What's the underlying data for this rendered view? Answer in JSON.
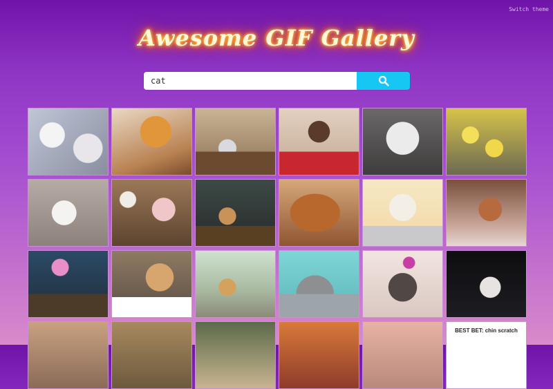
{
  "header": {
    "switch_theme": "Switch theme",
    "title": "Awesome GIF Gallery"
  },
  "search": {
    "value": "cat",
    "button_icon": "search-icon",
    "button_color": "#16c7f4"
  },
  "gallery": {
    "tiles": [
      {
        "icon": "gif-thumbnail"
      },
      {
        "icon": "gif-thumbnail"
      },
      {
        "icon": "gif-thumbnail"
      },
      {
        "icon": "gif-thumbnail"
      },
      {
        "icon": "gif-thumbnail"
      },
      {
        "icon": "gif-thumbnail"
      },
      {
        "icon": "gif-thumbnail"
      },
      {
        "icon": "gif-thumbnail"
      },
      {
        "icon": "gif-thumbnail"
      },
      {
        "icon": "gif-thumbnail"
      },
      {
        "icon": "gif-thumbnail"
      },
      {
        "icon": "gif-thumbnail"
      },
      {
        "icon": "gif-thumbnail"
      },
      {
        "icon": "gif-thumbnail"
      },
      {
        "icon": "gif-thumbnail"
      },
      {
        "icon": "gif-thumbnail"
      },
      {
        "icon": "gif-thumbnail"
      },
      {
        "icon": "gif-thumbnail"
      },
      {
        "icon": "gif-thumbnail"
      },
      {
        "icon": "gif-thumbnail"
      },
      {
        "icon": "gif-thumbnail"
      },
      {
        "icon": "gif-thumbnail"
      },
      {
        "icon": "gif-thumbnail"
      },
      {
        "icon": "gif-thumbnail",
        "caption": "BEST BET: chin scratch"
      }
    ]
  },
  "colors": {
    "background_top": "#6f14a8",
    "background_bottom": "#d98acb",
    "title_glow": "#ff6a00"
  }
}
